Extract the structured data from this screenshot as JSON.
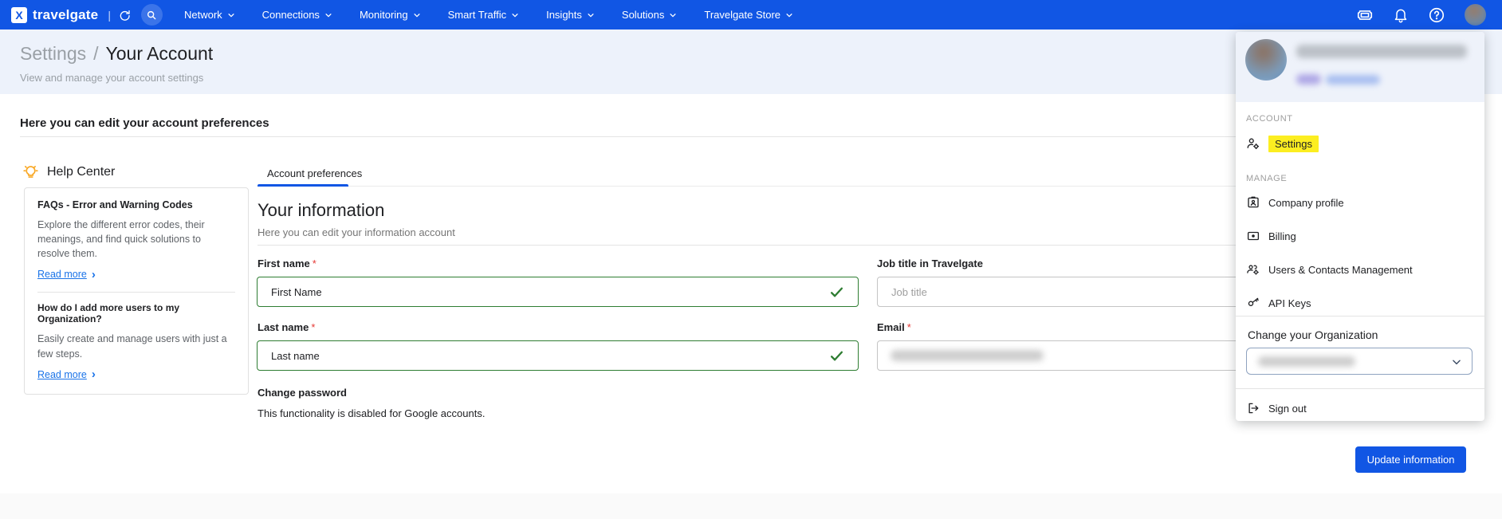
{
  "colors": {
    "accent": "#1156e4",
    "link": "#1a73e8",
    "green": "#2e7d32",
    "highlight": "#fcee21"
  },
  "nav": {
    "brand": "travelgate",
    "logo_letter": "X",
    "brand_separator": "|",
    "menu": [
      {
        "label": "Network"
      },
      {
        "label": "Connections"
      },
      {
        "label": "Monitoring"
      },
      {
        "label": "Smart Traffic"
      },
      {
        "label": "Insights"
      },
      {
        "label": "Solutions"
      },
      {
        "label": "Travelgate Store"
      }
    ],
    "right_icons": [
      "ticket-icon",
      "bell-icon",
      "help-icon",
      "avatar"
    ]
  },
  "breadcrumb": {
    "section": "Settings",
    "separator": "/",
    "page": "Your Account",
    "subtitle": "View and manage your account settings"
  },
  "page": {
    "heading": "Here you can edit your account preferences"
  },
  "help_center": {
    "title": "Help Center",
    "icon": "lightbulb-icon",
    "articles": [
      {
        "title": "FAQs - Error and Warning Codes",
        "body": "Explore the different error codes, their meanings, and find quick solutions to resolve them.",
        "link": "Read more",
        "chevron": "›"
      },
      {
        "title": "How do I add more users to my Organization?",
        "body": "Easily create and manage users with just a few steps.",
        "link": "Read more",
        "chevron": "›"
      }
    ]
  },
  "form": {
    "tab": "Account preferences",
    "title": "Your information",
    "subtitle": "Here you can edit your information account",
    "fields": {
      "first_name": {
        "label": "First name",
        "required": "*",
        "value": "First Name"
      },
      "last_name": {
        "label": "Last name",
        "required": "*",
        "value": "Last name"
      },
      "job_title": {
        "label": "Job title in Travelgate",
        "placeholder": "Job title"
      },
      "email": {
        "label": "Email",
        "required": "*"
      }
    },
    "change_password": {
      "label": "Change password",
      "note": "This functionality is disabled for Google accounts."
    },
    "submit_label": "Update information"
  },
  "account_menu": {
    "sections": [
      {
        "label": "ACCOUNT",
        "items": [
          {
            "label": "Settings",
            "icon": "settings-person-icon",
            "highlighted": true
          }
        ]
      },
      {
        "label": "MANAGE",
        "items": [
          {
            "label": "Company profile",
            "icon": "company-profile-icon"
          },
          {
            "label": "Billing",
            "icon": "billing-icon"
          },
          {
            "label": "Users & Contacts Management",
            "icon": "users-contacts-icon"
          },
          {
            "label": "API Keys",
            "icon": "api-key-icon"
          }
        ]
      }
    ],
    "organization": {
      "label": "Change your Organization"
    },
    "sign_out": {
      "label": "Sign out",
      "icon": "sign-out-icon"
    }
  }
}
